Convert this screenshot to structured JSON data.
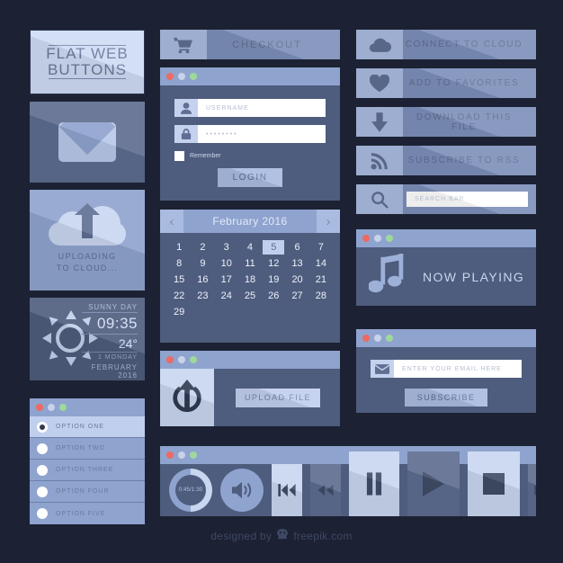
{
  "title_card": {
    "line1": "FLAT WEB",
    "line2": "BUTTONS"
  },
  "tiles": {
    "mail": {
      "icon": "envelope-icon"
    },
    "cloud_upload": {
      "icon": "cloud-upload-icon",
      "caption_line1": "UPLOADING",
      "caption_line2": "TO CLOUD..."
    },
    "weather": {
      "icon": "sun-icon",
      "condition": "SUNNY DAY",
      "time": "09:35",
      "temperature": "24°",
      "day": "1 MONDAY",
      "month_year": "FEBRUARY 2016"
    }
  },
  "radio_panel": {
    "options": [
      {
        "label": "OPTION ONE",
        "selected": true
      },
      {
        "label": "OPTION TWO",
        "selected": false
      },
      {
        "label": "OPTION THREE",
        "selected": false
      },
      {
        "label": "OPTION FOUR",
        "selected": false
      },
      {
        "label": "OPTION FIVE",
        "selected": false
      }
    ]
  },
  "checkout_button": {
    "label": "CHECKOUT",
    "icon": "shopping-cart-icon"
  },
  "login_panel": {
    "username_placeholder": "USERNAME",
    "username_icon": "user-icon",
    "password_value": "••••••••",
    "password_icon": "lock-icon",
    "remember_label": "Remember",
    "remember_checked": false,
    "login_label": "LOGIN"
  },
  "calendar": {
    "prev_icon": "chevron-left-icon",
    "next_icon": "chevron-right-icon",
    "month_title": "February 2016",
    "days": [
      1,
      2,
      3,
      4,
      5,
      6,
      7,
      8,
      9,
      10,
      11,
      12,
      13,
      14,
      15,
      16,
      17,
      18,
      19,
      20,
      21,
      22,
      23,
      24,
      25,
      26,
      27,
      28,
      29
    ],
    "selected_day": 5
  },
  "upload_panel": {
    "icon": "power-upload-icon",
    "button_label": "UPLOAD FILE"
  },
  "right_buttons": [
    {
      "label": "CONNECT TO CLOUD",
      "icon": "cloud-icon"
    },
    {
      "label": "ADD TO FAVORITES",
      "icon": "heart-icon"
    },
    {
      "label": "DOWNLOAD THIS FILE",
      "icon": "download-arrow-icon"
    },
    {
      "label": "SUBSCRIBE TO RSS",
      "icon": "rss-icon"
    },
    {
      "label": "",
      "icon": "search-icon",
      "placeholder": "SEARCH BAR"
    }
  ],
  "now_playing": {
    "icon": "music-note-icon",
    "label": "NOW PLAYING"
  },
  "subscribe_panel": {
    "email_icon": "envelope-icon",
    "email_placeholder": "ENTER YOUR EMAIL HERE",
    "button_label": "SUBSCRIBE"
  },
  "media_bar": {
    "progress_time": "0:45/1:30",
    "volume_icon": "speaker-icon",
    "controls": [
      {
        "name": "previous-track",
        "icon": "skip-back-icon"
      },
      {
        "name": "rewind",
        "icon": "rewind-icon"
      },
      {
        "name": "pause",
        "icon": "pause-icon"
      },
      {
        "name": "play",
        "icon": "play-icon"
      },
      {
        "name": "stop",
        "icon": "stop-icon"
      },
      {
        "name": "fast-forward",
        "icon": "fast-forward-icon"
      },
      {
        "name": "next-track",
        "icon": "skip-forward-icon"
      }
    ]
  },
  "footer": {
    "prefix": "designed by",
    "icon": "freepik-logo-icon",
    "brand": "freepik.com"
  },
  "colors": {
    "background": "#1c2233",
    "panel_dark": "#4e5c7d",
    "panel_mid": "#7d8fba",
    "panel_light": "#c9d6f0",
    "accent_red": "#ec6a62",
    "accent_green": "#9ed99b",
    "accent_gray": "#c8d3ea"
  }
}
